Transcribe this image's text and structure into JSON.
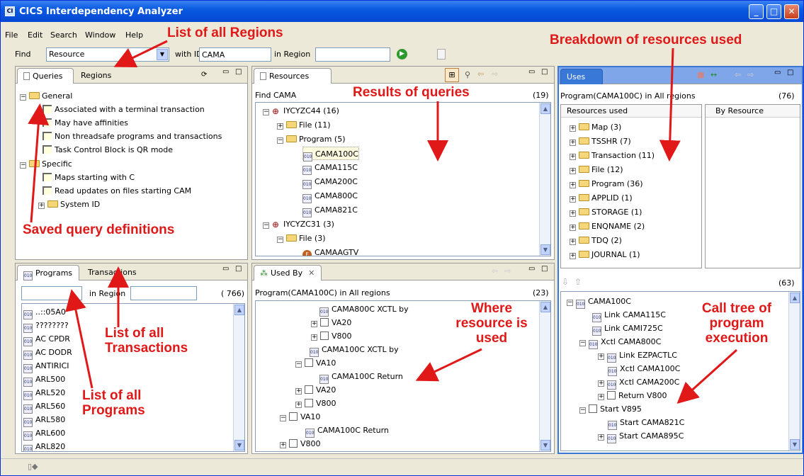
{
  "window": {
    "title": "CICS Interdependency Analyzer"
  },
  "menu": [
    "File",
    "Edit",
    "Search",
    "Window",
    "Help"
  ],
  "find_bar": {
    "find_label": "Find",
    "type_value": "Resource",
    "with_id_label": "with ID",
    "id_value": "CAMA",
    "in_region_label": "in Region",
    "region_value": ""
  },
  "queries_panel": {
    "tabs": [
      "Queries",
      "Regions"
    ],
    "general": "General",
    "general_items": [
      "Associated with a terminal transaction",
      "May have affinities",
      "Non threadsafe programs and transactions",
      "Task Control Block is QR mode"
    ],
    "specific": "Specific",
    "specific_items": [
      "Maps starting with C",
      "Read updates on files starting CAM"
    ],
    "system_id": "System ID"
  },
  "resources_panel": {
    "tab": "Resources",
    "find_label": "Find CAMA",
    "count": "(19)",
    "r1": "IYCYZC44 (16)",
    "r1_file": "File (11)",
    "r1_program": "Program (5)",
    "programs": [
      "CAMA100C",
      "CAMA115C",
      "CAMA200C",
      "CAMA800C",
      "CAMA821C"
    ],
    "r2": "IYCYZC31 (3)",
    "r2_file": "File (3)",
    "r2_item": "CAMAAGTV"
  },
  "uses_panel": {
    "tab": "Uses",
    "header": "Program(CAMA100C) in All regions",
    "count": "(76)",
    "col1": "Resources used",
    "col2": "By Resource",
    "items": [
      "Map (3)",
      "TSSHR (7)",
      "Transaction (11)",
      "File (12)",
      "Program (36)",
      "APPLID (1)",
      "STORAGE (1)",
      "ENQNAME (2)",
      "TDQ (2)",
      "JOURNAL (1)"
    ],
    "tree_count": "(63)",
    "tree": [
      "CAMA100C",
      "Link CAMA115C",
      "Link CAMI725C",
      "Xctl CAMA800C",
      "Link EZPACTLC",
      "Xctl CAMA100C",
      "Xctl CAMA200C",
      "Return V800",
      "Start V895",
      "Start CAMA821C",
      "Start CAMA895C"
    ]
  },
  "programs_panel": {
    "tabs": [
      "Programs",
      "Transactions"
    ],
    "in_region_label": "in Region",
    "count": "( 766)",
    "items": [
      "..::05A0",
      "????????",
      "AC CPDR",
      "AC DODR",
      "ANTIRICI",
      "ARL500",
      "ARL520",
      "ARL560",
      "ARL580",
      "ARL600",
      "ARL820"
    ]
  },
  "usedby_panel": {
    "tab": "Used By",
    "header": "Program(CAMA100C) in All regions",
    "count": "(23)",
    "rows": [
      "CAMA800C XCTL by",
      "VA20",
      "V800",
      "CAMA100C XCTL by",
      "VA10",
      "CAMA100C Return",
      "VA20",
      "V800",
      "VA10",
      "CAMA100C Return",
      "V800"
    ]
  },
  "annotations": {
    "regions": "List of all Regions",
    "breakdown": "Breakdown of resources used",
    "results": "Results of queries",
    "saved": "Saved query definitions",
    "where": "Where resource is used",
    "calltree": "Call tree of program execution",
    "transactions": "List of all Transactions",
    "programs": "List of all Programs",
    "annotation_color": "#e01818"
  }
}
